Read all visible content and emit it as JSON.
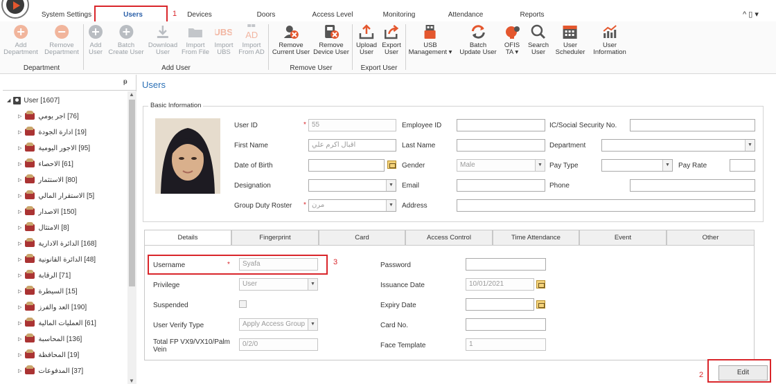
{
  "menu": {
    "tabs": [
      {
        "label": "System Settings"
      },
      {
        "label": "Users"
      },
      {
        "label": "Devices"
      },
      {
        "label": "Doors"
      },
      {
        "label": "Access Level"
      },
      {
        "label": "Monitoring"
      },
      {
        "label": "Attendance"
      },
      {
        "label": "Reports"
      }
    ],
    "active_tab": "Users",
    "window_controls": "^ ▯ ▾"
  },
  "annotations": {
    "one": "1",
    "two": "2",
    "three": "3"
  },
  "ribbon": {
    "buttons": [
      {
        "label1": "Add",
        "label2": "Department",
        "icon": "add-circle-icon",
        "disabled": true
      },
      {
        "label1": "Remove",
        "label2": "Department",
        "icon": "remove-circle-icon",
        "disabled": true
      },
      {
        "label1": "Add",
        "label2": "User",
        "icon": "add-user-icon",
        "disabled": true
      },
      {
        "label1": "Batch",
        "label2": "Create User",
        "icon": "batch-user-icon",
        "disabled": true
      },
      {
        "label1": "Download",
        "label2": "User",
        "icon": "download-icon",
        "disabled": true
      },
      {
        "label1": "Import",
        "label2": "From File",
        "icon": "folder-icon",
        "disabled": true
      },
      {
        "label1": "Import",
        "label2": "UBS",
        "icon": "ubs-icon",
        "disabled": true
      },
      {
        "label1": "Import",
        "label2": "From AD",
        "icon": "ad-icon",
        "disabled": true
      },
      {
        "label1": "Remove",
        "label2": "Current User",
        "icon": "remove-user-icon",
        "disabled": false
      },
      {
        "label1": "Remove",
        "label2": "Device User",
        "icon": "remove-device-user-icon",
        "disabled": false
      },
      {
        "label1": "Upload",
        "label2": "User",
        "icon": "upload-icon",
        "disabled": false
      },
      {
        "label1": "Export",
        "label2": "User",
        "icon": "export-icon",
        "disabled": false
      },
      {
        "label1": "USB",
        "label2": "Management ▾",
        "icon": "usb-icon",
        "disabled": false
      },
      {
        "label1": "Batch",
        "label2": "Update User",
        "icon": "refresh-icon",
        "disabled": false
      },
      {
        "label1": "OFIS",
        "label2": "TA ▾",
        "icon": "ofis-icon",
        "disabled": false
      },
      {
        "label1": "Search",
        "label2": "User",
        "icon": "search-icon",
        "disabled": false
      },
      {
        "label1": "User",
        "label2": "Scheduler",
        "icon": "calendar-icon",
        "disabled": false
      },
      {
        "label1": "User",
        "label2": "Information",
        "icon": "chart-icon",
        "disabled": false
      }
    ],
    "groups": [
      {
        "label": "Department"
      },
      {
        "label": "Add User"
      },
      {
        "label": "Remove User"
      },
      {
        "label": "Export User"
      }
    ]
  },
  "tree": {
    "pin": "ᵽ",
    "root": "User [1607]",
    "items": [
      "[76] اجر يومي",
      "[19] ادارة الجودة",
      "[95] الاجور اليومية",
      "[61] الاحصاء",
      "[80] الاستثمار",
      "[5] الاستقرار المالي",
      "[150] الاصدار",
      "[8] الامتثال",
      "[168] الدائرة الادارية",
      "[48] الدائرة القانونية",
      "[71] الرقابة",
      "[15] السيطرة",
      "[190] العد والفرز",
      "[61] العمليات المالية",
      "[136] المحاسبة",
      "[19] المحافظة",
      "[37] المدفوعات"
    ]
  },
  "main": {
    "title": "Users",
    "basic_legend": "Basic Information",
    "fields": {
      "user_id": {
        "label": "User ID",
        "value": "55"
      },
      "first_name": {
        "label": "First Name",
        "value": "اقبال اكرم علي"
      },
      "date_of_birth": {
        "label": "Date of Birth",
        "value": ""
      },
      "designation": {
        "label": "Designation",
        "value": ""
      },
      "group_duty_roster": {
        "label": "Group Duty Roster",
        "value": "مرن"
      },
      "employee_id": {
        "label": "Employee ID",
        "value": ""
      },
      "last_name": {
        "label": "Last Name",
        "value": ""
      },
      "gender": {
        "label": "Gender",
        "value": "Male"
      },
      "email": {
        "label": "Email",
        "value": ""
      },
      "address": {
        "label": "Address",
        "value": ""
      },
      "ic_no": {
        "label": "IC/Social Security No.",
        "value": ""
      },
      "department": {
        "label": "Department",
        "value": ""
      },
      "pay_type": {
        "label": "Pay Type",
        "value": ""
      },
      "pay_rate": {
        "label": "Pay Rate",
        "value": ""
      },
      "phone": {
        "label": "Phone",
        "value": ""
      }
    },
    "required_mark": "*",
    "tabs": [
      "Details",
      "Fingerprint",
      "Card",
      "Access Control",
      "Time Attendance",
      "Event",
      "Other"
    ],
    "details": {
      "username": {
        "label": "Username",
        "value": "Syafa"
      },
      "privilege": {
        "label": "Privilege",
        "value": "User"
      },
      "suspended": {
        "label": "Suspended"
      },
      "verify_type": {
        "label": "User Verify Type",
        "value": "Apply Access Group"
      },
      "total_fp": {
        "label": "Total FP VX9/VX10/Palm Vein",
        "value": "0/2/0"
      },
      "password": {
        "label": "Password",
        "value": ""
      },
      "issuance_date": {
        "label": "Issuance Date",
        "value": "10/01/2021"
      },
      "expiry_date": {
        "label": "Expiry Date",
        "value": ""
      },
      "card_no": {
        "label": "Card No.",
        "value": ""
      },
      "face_template": {
        "label": "Face Template",
        "value": "1"
      }
    },
    "edit_label": "Edit"
  },
  "colors": {
    "accent": "#2a6fb5",
    "annotation_red": "#d9252a",
    "active_tab": "#2a5fa8"
  }
}
